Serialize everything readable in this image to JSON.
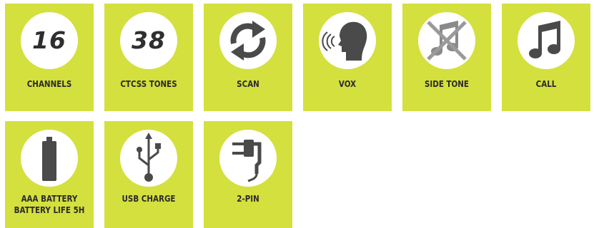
{
  "features": [
    {
      "label": "CHANNELS",
      "value": "16",
      "icon": "number-16-icon"
    },
    {
      "label": "CTCSS TONES",
      "value": "38",
      "icon": "number-38-icon"
    },
    {
      "label": "SCAN",
      "icon": "scan-arrows-icon"
    },
    {
      "label": "VOX",
      "icon": "voice-head-icon"
    },
    {
      "label": "SIDE TONE",
      "icon": "muted-note-icon"
    },
    {
      "label": "CALL",
      "icon": "music-note-icon"
    },
    {
      "label_line1": "AAA BATTERY",
      "label_line2": "BATTERY LIFE 5H",
      "icon": "battery-icon"
    },
    {
      "label": "USB CHARGE",
      "icon": "usb-icon"
    },
    {
      "label": "2-PIN",
      "icon": "two-pin-plug-icon"
    }
  ],
  "colors": {
    "tile": "#d4e03e",
    "icon": "#4a4a4a",
    "text": "#2b2b2b",
    "circle": "#ffffff"
  }
}
